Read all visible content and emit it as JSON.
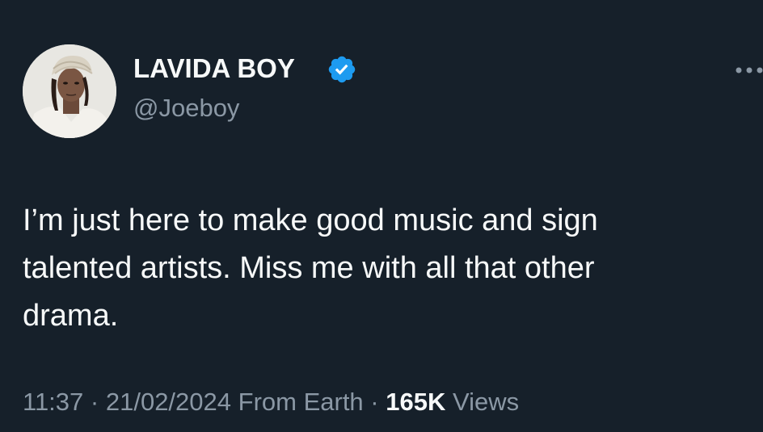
{
  "tweet": {
    "display_name": "LAVIDA BOY",
    "handle": "@Joeboy",
    "verified": true,
    "text": "I’m just here to make good music and sign\ntalented artists. Miss me with all that other\ndrama.",
    "time": "11:37",
    "separator": "·",
    "date": "21/02/2024",
    "source": "From Earth",
    "views_count": "165K",
    "views_label": "Views"
  },
  "icons": {
    "verified": "verified-badge-icon",
    "more": "more-options-icon"
  },
  "colors": {
    "background": "#16202a",
    "primary_text": "#f7f9f9",
    "secondary_text": "#8b98a5",
    "verified_blue": "#1d9bf0"
  }
}
